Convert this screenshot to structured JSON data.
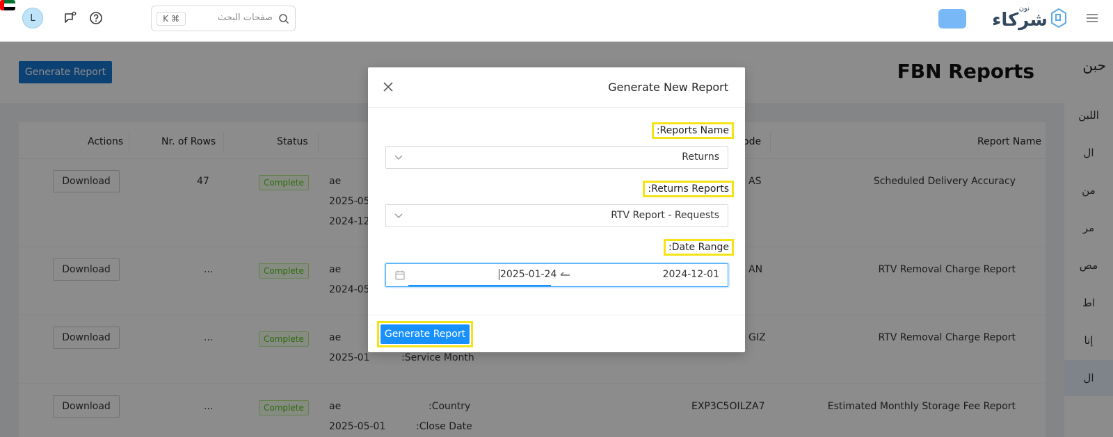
{
  "topbar": {
    "avatar_letter": "L",
    "search_placeholder": "صفحات البحث",
    "shortcut_key": "K",
    "shortcut_mod": "⌘",
    "logo_text": "شركاء",
    "logo_sub": "نون"
  },
  "page": {
    "title": "FBN Reports",
    "generate_button": "Generate Report"
  },
  "rail": {
    "title": "حبن",
    "items": [
      "اللبن",
      "ال",
      "من",
      "مر",
      "مص",
      "اط",
      "إنا",
      "ال"
    ]
  },
  "table": {
    "headers": {
      "report_name": "Report Name",
      "code": "ode",
      "status": "Status",
      "rows": "Nr. of Rows",
      "actions": "Actions"
    },
    "rows": [
      {
        "name": "Scheduled Delivery Accuracy",
        "code": "AS",
        "status": "Complete",
        "nrows": "47",
        "p1": "ae",
        "p2": "2025-05",
        "p3": "2024-12",
        "l2": "",
        "l3": "",
        "action": "Download"
      },
      {
        "name": "RTV Removal Charge Report",
        "code": "AN",
        "status": "Complete",
        "nrows": "...",
        "p1": "ae",
        "p2": "2024-05",
        "p3": "",
        "l2": "",
        "l3": "",
        "action": "Download"
      },
      {
        "name": "RTV Removal Charge Report",
        "code": "GIZ",
        "status": "Complete",
        "nrows": "...",
        "p1": "ae",
        "p2": "2025-01",
        "p3": "",
        "l2": ":Service Month",
        "l3": "",
        "action": "Download"
      },
      {
        "name": "Estimated Monthly Storage Fee Report",
        "code": "EXP3C5OILZA7",
        "status": "Complete",
        "nrows": "...",
        "p1": "ae",
        "p2": "2025-05-01",
        "p3": "",
        "l1": ":Country",
        "l2": ":Close Date",
        "action": "Download"
      }
    ]
  },
  "modal": {
    "title": "Generate New Report",
    "reports_name_label": ":Reports Name",
    "reports_name_value": "Returns",
    "returns_reports_label": ":Returns Reports",
    "returns_reports_value": "RTV Report - Requests",
    "date_range_label": ":Date Range",
    "date_start": "2024-12-01",
    "date_end": "2025-01-24",
    "generate_button": "Generate Report"
  },
  "colors": {
    "primary": "#1890ff",
    "highlight": "#f5e415",
    "success": "#52c41a"
  }
}
